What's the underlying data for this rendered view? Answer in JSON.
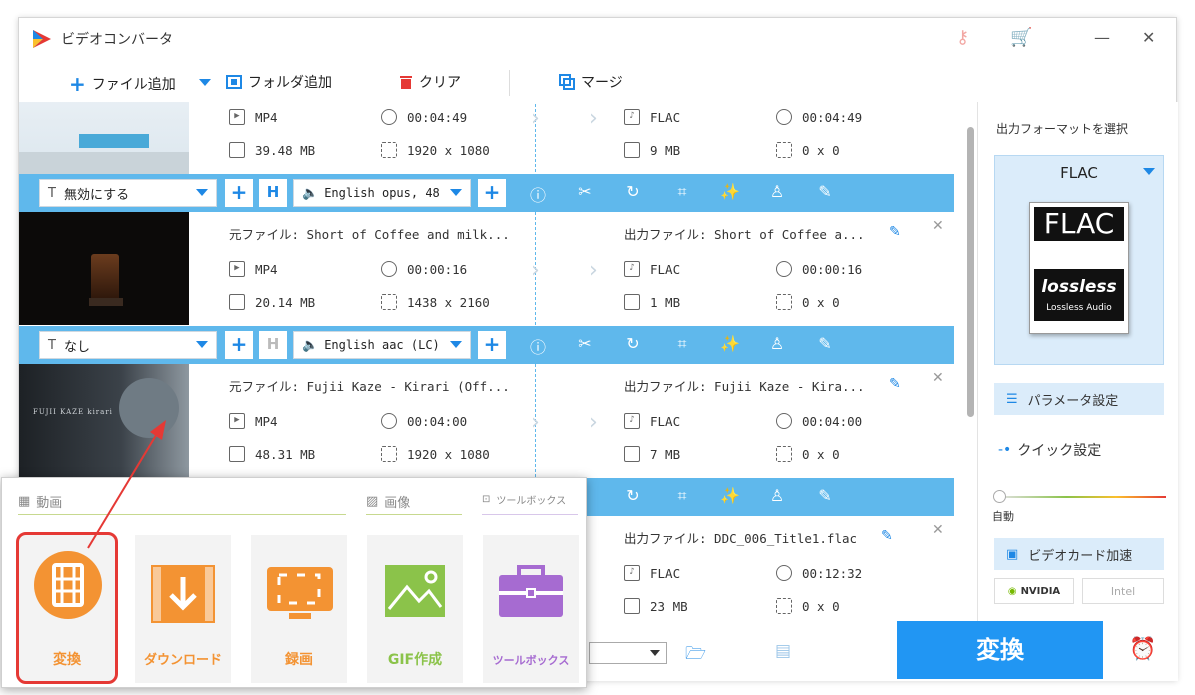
{
  "app": {
    "title": "ビデオコンバータ"
  },
  "toolbar": {
    "add_file": "ファイル追加",
    "add_folder": "フォルダ追加",
    "clear": "クリア",
    "merge": "マージ"
  },
  "files": [
    {
      "source_format": "MP4",
      "source_duration": "00:04:49",
      "source_size": "39.48 MB",
      "source_resolution": "1920 x 1080",
      "output_format": "FLAC",
      "output_duration": "00:04:49",
      "output_size": "9 MB",
      "output_resolution": "0 x 0",
      "subtitle": "無効にする",
      "audio_track": "English opus, 48"
    },
    {
      "source_name": "元ファイル: Short of Coffee and milk...",
      "output_name": "出力ファイル: Short of Coffee a...",
      "source_format": "MP4",
      "source_duration": "00:00:16",
      "source_size": "20.14 MB",
      "source_resolution": "1438 x 2160",
      "output_format": "FLAC",
      "output_duration": "00:00:16",
      "output_size": "1 MB",
      "output_resolution": "0 x 0",
      "subtitle": "なし",
      "audio_track": "English aac (LC)"
    },
    {
      "source_name": "元ファイル: Fujii Kaze - Kirari (Off...",
      "output_name": "出力ファイル: Fujii Kaze - Kira...",
      "source_format": "MP4",
      "source_duration": "00:04:00",
      "source_size": "48.31 MB",
      "source_resolution": "1920 x 1080",
      "output_format": "FLAC",
      "output_duration": "00:04:00",
      "output_size": "7 MB",
      "output_resolution": "0 x 0",
      "thumb_text": "FUJII KAZE kirari"
    },
    {
      "output_name": "出力ファイル: DDC_006_Title1.flac",
      "output_format": "FLAC",
      "output_duration": "00:12:32",
      "output_size": "23 MB",
      "output_resolution": "0 x 0"
    }
  ],
  "right_panel": {
    "output_format_heading": "出力フォーマットを選択",
    "selected_format": "FLAC",
    "format_logo_text": "FLAC",
    "format_logo_sub": "lossless",
    "format_logo_caption": "Lossless Audio",
    "param_settings": "パラメータ設定",
    "quick_settings": "クイック設定",
    "slider_label": "自動",
    "gpu_accel": "ビデオカード加速",
    "gpu_nvidia": "NVIDIA",
    "gpu_intel": "Intel"
  },
  "bottom": {
    "convert_button": "変換"
  },
  "popup": {
    "section_video": "動画",
    "section_image": "画像",
    "section_toolbox": "ツールボックス",
    "tiles": [
      "変換",
      "ダウンロード",
      "録画",
      "GIF作成",
      "ツールボックス"
    ]
  },
  "colors": {
    "accent": "#2196f3",
    "control_bar": "#5fb8ec",
    "orange": "#f39333",
    "green": "#8bc34a",
    "purple": "#a66bd1",
    "highlight": "#e53935"
  }
}
